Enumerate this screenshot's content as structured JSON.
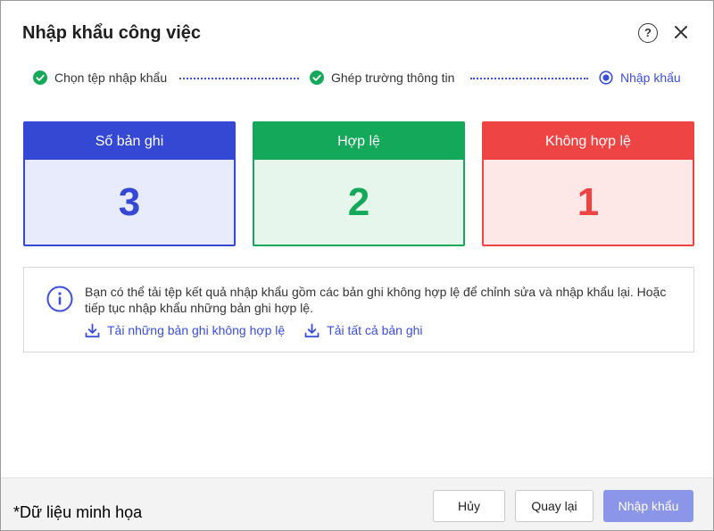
{
  "dialog": {
    "title": "Nhập khẩu công việc",
    "help_label": "?"
  },
  "steps": [
    {
      "label": "Chọn tệp nhập khẩu",
      "state": "done"
    },
    {
      "label": "Ghép trường thông tin",
      "state": "done"
    },
    {
      "label": "Nhập khẩu",
      "state": "current"
    }
  ],
  "summary": {
    "total": {
      "label": "Số bản ghi",
      "value": "3"
    },
    "valid": {
      "label": "Hợp lệ",
      "value": "2"
    },
    "invalid": {
      "label": "Không hợp lệ",
      "value": "1"
    }
  },
  "info": {
    "message": "Bạn có thể tải tệp kết quả nhập khẩu gồm các bản ghi không hợp lệ để chỉnh sửa và nhập khẩu lại. Hoặc tiếp tục nhập khẩu những bản ghi hợp lệ.",
    "download_invalid": "Tải những bản ghi không hợp lệ",
    "download_all": "Tải tất cả bản ghi"
  },
  "footer": {
    "note": "*Dữ liệu minh họa",
    "cancel": "Hủy",
    "back": "Quay lại",
    "import": "Nhập khẩu"
  },
  "colors": {
    "primary": "#3548d4",
    "valid": "#14a85a",
    "invalid": "#ef4444",
    "import_button": "#8c96e8"
  }
}
